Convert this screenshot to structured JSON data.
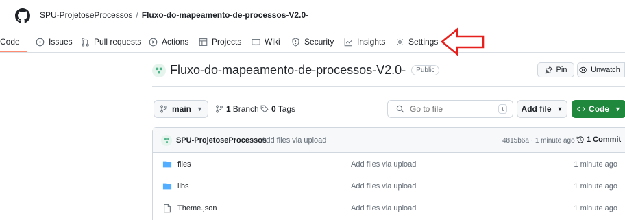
{
  "breadcrumb": {
    "owner": "SPU-ProjetoseProcessos",
    "separator": "/",
    "repo": "Fluxo-do-mapeamento-de-processos-V2.0-"
  },
  "nav": {
    "tabs": [
      {
        "label": "Code",
        "icon": "code-icon"
      },
      {
        "label": "Issues",
        "icon": "issue-icon"
      },
      {
        "label": "Pull requests",
        "icon": "pull-request-icon"
      },
      {
        "label": "Actions",
        "icon": "play-icon"
      },
      {
        "label": "Projects",
        "icon": "table-icon"
      },
      {
        "label": "Wiki",
        "icon": "book-icon"
      },
      {
        "label": "Security",
        "icon": "shield-icon"
      },
      {
        "label": "Insights",
        "icon": "graph-icon"
      },
      {
        "label": "Settings",
        "icon": "gear-icon"
      }
    ],
    "active_tab": "Code"
  },
  "repo_header": {
    "title": "Fluxo-do-mapeamento-de-processos-V2.0-",
    "visibility": "Public",
    "pin_label": "Pin",
    "watch_label": "Unwatch"
  },
  "toolbar": {
    "branch": "main",
    "branches_count": "1",
    "branches_label": "Branch",
    "tags_count": "0",
    "tags_label": "Tags",
    "search_placeholder": "Go to file",
    "search_shortcut": "t",
    "add_file_label": "Add file",
    "code_label": "Code"
  },
  "latest_commit": {
    "author": "SPU-ProjetoseProcessos",
    "message": "Add files via upload",
    "meta": "4815b6a · 1 minute ago",
    "commits_label": "1 Commit"
  },
  "files": [
    {
      "name": "files",
      "type": "folder",
      "message": "Add files via upload",
      "time": "1 minute ago"
    },
    {
      "name": "libs",
      "type": "folder",
      "message": "Add files via upload",
      "time": "1 minute ago"
    },
    {
      "name": "Theme.json",
      "type": "file",
      "message": "Add files via upload",
      "time": "1 minute ago"
    }
  ],
  "colors": {
    "accent_underline": "#fd8c73",
    "code_button": "#1f883d",
    "folder": "#54aeff",
    "arrow": "#e5201d"
  }
}
